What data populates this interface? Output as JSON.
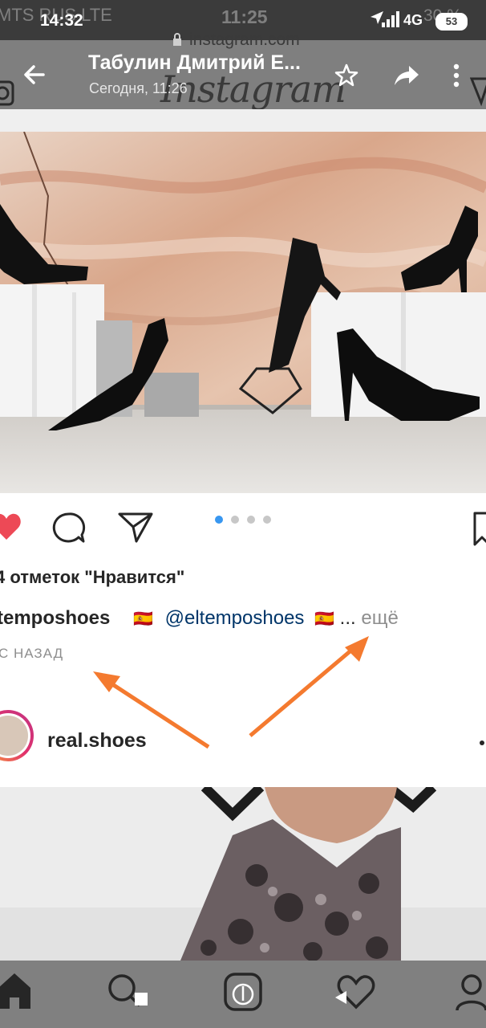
{
  "status_bar": {
    "time": "14:32",
    "carrier_ghost": "MTS RUS  LTE",
    "center_time_ghost": "11:25",
    "network": "4G",
    "battery": "53",
    "battery_ghost": "30 %"
  },
  "url_ghost": "instagram.com",
  "header": {
    "title": "Табулин Дмитрий Е...",
    "subtitle": "Сегодня, 11:26",
    "logo_ghost": "Instagram"
  },
  "post": {
    "likes_text": "4 отметок \"Нравится\"",
    "caption_user": "temposhoes",
    "caption_flag1": "🇪🇸",
    "caption_mention": "@eltemposhoes",
    "caption_flag2": "🇪🇸",
    "caption_ellipsis": "...",
    "caption_more": "ещё",
    "time_ago": "С НАЗАД",
    "carousel_dots": 4,
    "carousel_active": 1
  },
  "next_post": {
    "username": "real.shoes"
  },
  "colors": {
    "accent_dot": "#3897f0",
    "heart": "#ed4956",
    "arrow": "#f47a2f"
  }
}
